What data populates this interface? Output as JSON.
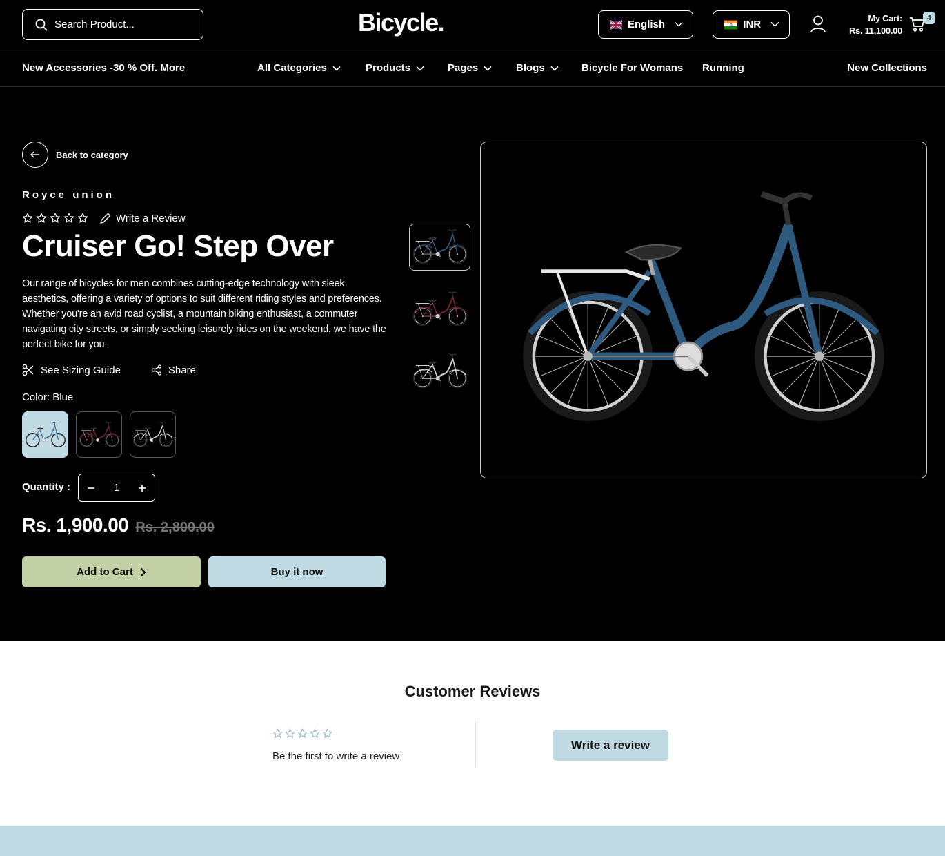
{
  "header": {
    "search_placeholder": "Search Product...",
    "logo": "Bicycle.",
    "language": "English",
    "currency": "INR",
    "cart_label": "My Cart:",
    "cart_total": "Rs. 11,100.00",
    "cart_count": "4"
  },
  "nav": {
    "promo_text": "New Accessories -30 % Off.",
    "promo_link": "More",
    "items": [
      {
        "label": "All Categories",
        "has_dropdown": true
      },
      {
        "label": "Products",
        "has_dropdown": true
      },
      {
        "label": "Pages",
        "has_dropdown": true
      },
      {
        "label": "Blogs",
        "has_dropdown": true
      },
      {
        "label": "Bicycle For Womans",
        "has_dropdown": false
      },
      {
        "label": "Running",
        "has_dropdown": false
      }
    ],
    "new_collections": "New Collections"
  },
  "product": {
    "back_label": "Back to category",
    "vendor": "Royce union",
    "rating": 0,
    "rating_max": 5,
    "write_review": "Write a Review",
    "title": "Cruiser Go! Step Over",
    "description": "Our range of bicycles for men combines cutting-edge technology with sleek aesthetics, offering a variety of options to suit different riding styles and preferences. Whether you're an avid road cyclist, a mountain biking enthusiast, a commuter navigating city streets, or simply seeking leisurely rides on the weekend, we have the perfect bike for you.",
    "sizing_guide": "See Sizing Guide",
    "share": "Share",
    "color_label": "Color:",
    "color_value": "Blue",
    "color_options": [
      {
        "frame_color": "#3c6e96",
        "selected": true
      },
      {
        "frame_color": "#7a2236",
        "selected": false
      },
      {
        "frame_color": "#d8d4cc",
        "selected": false
      }
    ],
    "quantity_label": "Quantity :",
    "quantity": "1",
    "price": "Rs. 1,900.00",
    "compare_price": "Rs. 2,800.00",
    "add_to_cart": "Add to Cart",
    "buy_now": "Buy it now",
    "gallery": [
      {
        "frame_color": "#2c5478",
        "active": true
      },
      {
        "frame_color": "#7a2236",
        "active": false
      },
      {
        "frame_color": "#d8d4cc",
        "active": false
      }
    ],
    "main_image_color": "#2e5a80"
  },
  "reviews": {
    "heading": "Customer Reviews",
    "empty_text": "Be the first to write a review",
    "write_button": "Write a review"
  },
  "colors": {
    "accent_blue": "#c0dae4",
    "accent_green": "#c3cfa4"
  }
}
